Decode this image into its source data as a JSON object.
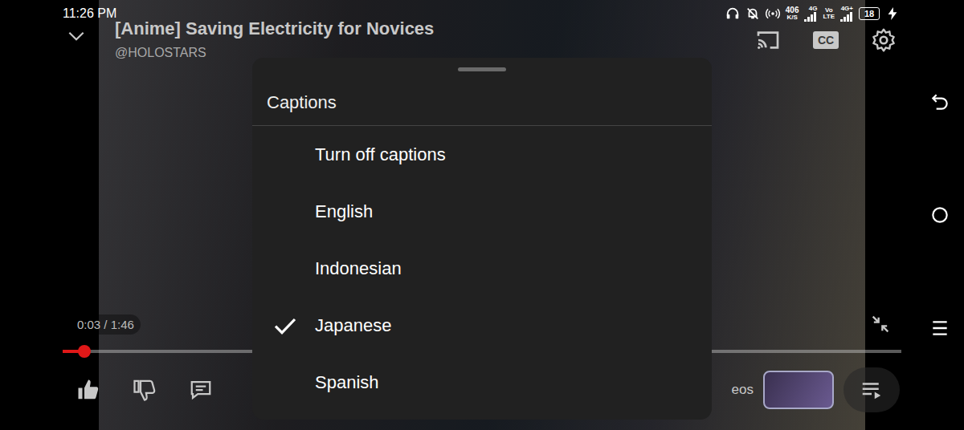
{
  "status_bar": {
    "time": "11:26 PM",
    "speed": "406",
    "speed_unit": "K/S",
    "network_1": "4G",
    "volte": [
      "Vo",
      "LTE"
    ],
    "network_2": "4G+",
    "battery": "18",
    "charging": true
  },
  "video": {
    "title": "[Anime] Saving Electricity for Novices",
    "channel": "@HOLOSTARS",
    "time": "0:03 / 1:46",
    "progress": {
      "level": 0.026
    }
  },
  "cc_button": "CC",
  "captions": {
    "title": "Captions",
    "options": [
      {
        "label": "Turn off captions",
        "selected": false
      },
      {
        "label": "English",
        "selected": false
      },
      {
        "label": "Indonesian",
        "selected": false
      },
      {
        "label": "Japanese",
        "selected": true
      },
      {
        "label": "Spanish",
        "selected": false
      }
    ]
  },
  "actions": {
    "videos_label": "eos"
  }
}
